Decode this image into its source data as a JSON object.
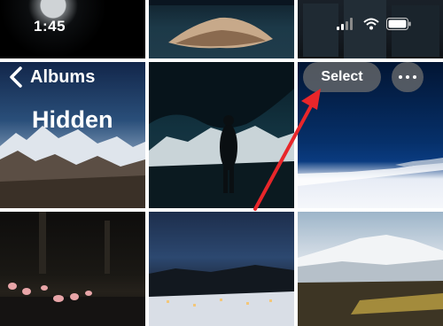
{
  "status_bar": {
    "time": "1:45",
    "icons": [
      "signal-icon",
      "wifi-icon",
      "battery-icon"
    ]
  },
  "nav": {
    "back_label": "Albums",
    "back_icon": "chevron-left-icon",
    "title": "Hidden",
    "select_label": "Select",
    "more_icon": "ellipsis-icon"
  },
  "colors": {
    "annotation_arrow": "#e8262a",
    "button_fill": "#6e6e6e"
  },
  "photos": [
    {
      "name": "moon-photo"
    },
    {
      "name": "island-photo"
    },
    {
      "name": "dark-window-photo"
    },
    {
      "name": "snowy-mountains-photo"
    },
    {
      "name": "cave-silhouette-photo"
    },
    {
      "name": "sea-coast-photo"
    },
    {
      "name": "flamingos-photo"
    },
    {
      "name": "winter-village-photo"
    },
    {
      "name": "mountain-meadow-photo"
    }
  ]
}
